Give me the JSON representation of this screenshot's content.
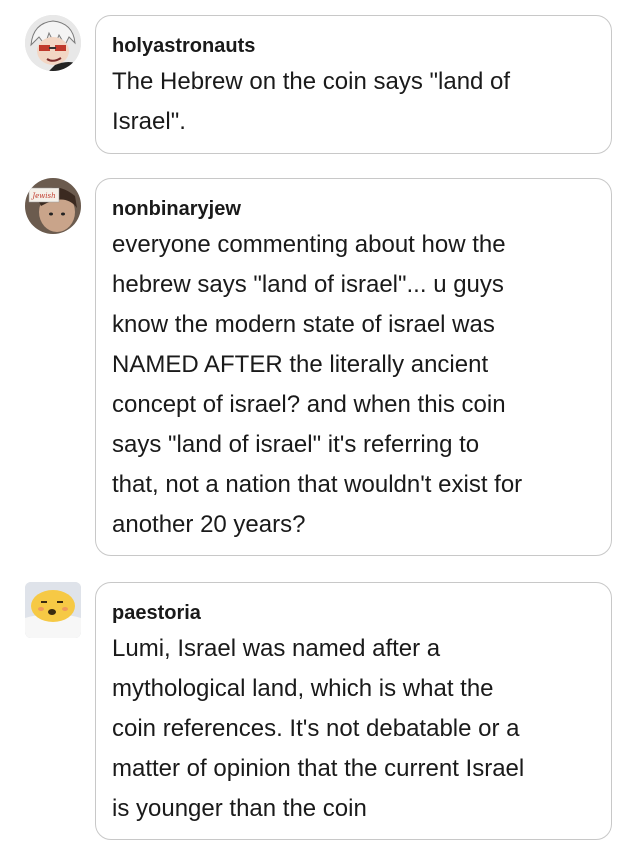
{
  "comments": [
    {
      "username": "holyastronauts",
      "lines": [
        "The Hebrew on the coin says \"land of",
        "Israel\"."
      ],
      "avatar_icon": "anime-character-avatar"
    },
    {
      "username": "nonbinaryjew",
      "lines": [
        "everyone commenting about how the",
        "hebrew says \"land of israel\"... u guys",
        "know the modern state of israel was",
        "NAMED AFTER the literally ancient",
        "concept of israel? and when this coin",
        "says \"land of israel\" it's referring to",
        "that, not a nation that wouldn't exist for",
        "another 20 years?"
      ],
      "avatar_icon": "person-with-sign-avatar",
      "avatar_sign_text": "Jewish"
    },
    {
      "username": "paestoria",
      "lines": [
        "Lumi, Israel was named after a",
        "mythological land, which is what the",
        "coin references. It's not debatable or a",
        "matter of opinion that the current Israel",
        "is younger than the coin"
      ],
      "avatar_icon": "gudetama-egg-avatar"
    }
  ],
  "colors": {
    "text": "#1a1a1a",
    "border": "#c8c8c8",
    "background": "#ffffff"
  }
}
